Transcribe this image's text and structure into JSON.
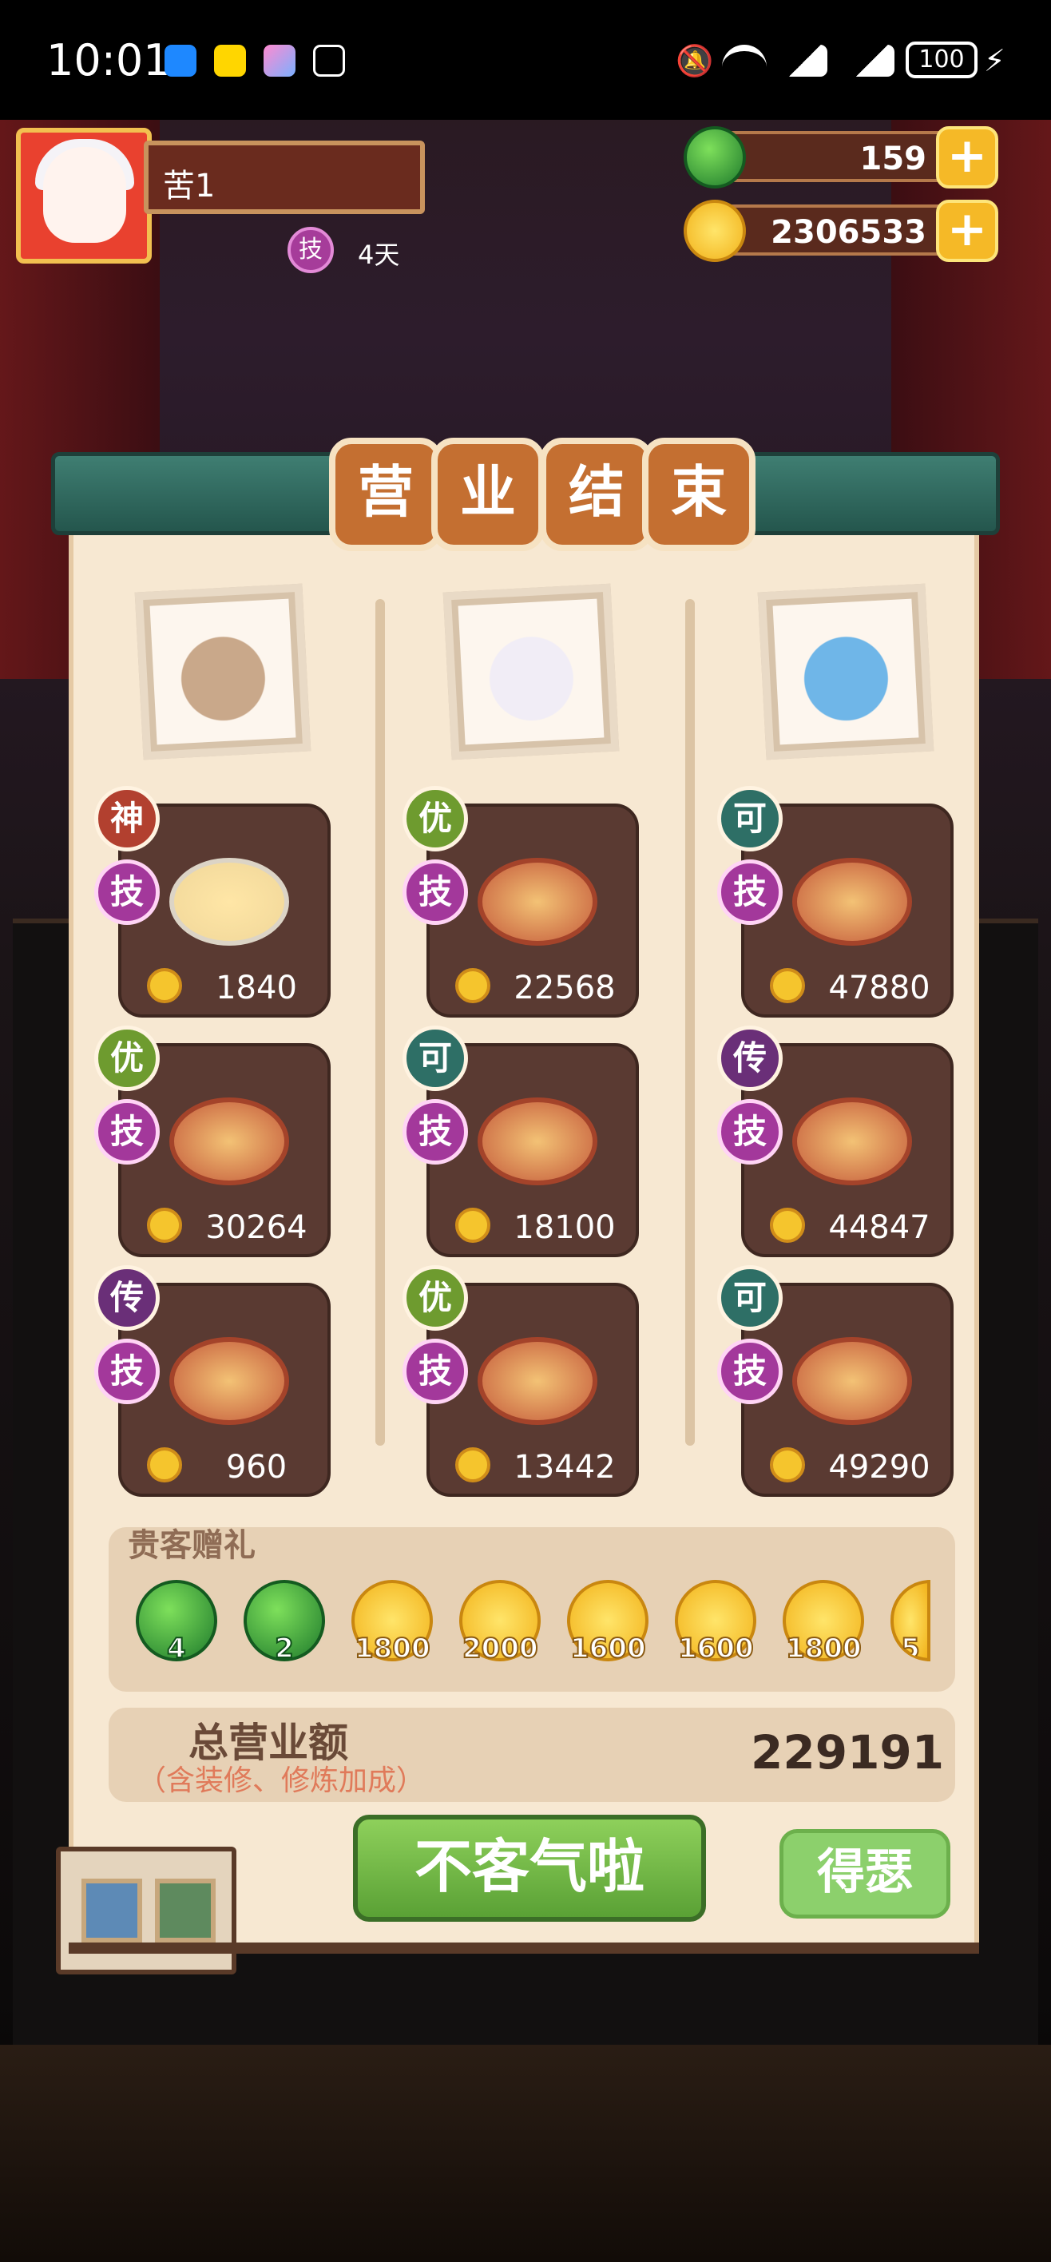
{
  "status_bar": {
    "time": "10:01",
    "left_icons": [
      "messages-icon",
      "meituan-icon",
      "gallery-icon",
      "bluetooth-icon"
    ],
    "right_icons": [
      "silent-icon",
      "wifi-icon",
      "signal-icon",
      "signal-icon",
      "battery-icon"
    ],
    "battery": "100"
  },
  "player": {
    "name": "苦1",
    "skill_badge": "技",
    "days": "4天"
  },
  "currency": {
    "jade": "159",
    "coins": "2306533"
  },
  "banner": [
    "营",
    "业",
    "结",
    "束"
  ],
  "chefs": [
    {
      "name": "chef-1",
      "dishes": [
        {
          "grade": "神",
          "grade_color": "#b2402f",
          "skill": "技",
          "price": "1840"
        },
        {
          "grade": "优",
          "grade_color": "#6e9b2f",
          "skill": "技",
          "price": "30264"
        },
        {
          "grade": "传",
          "grade_color": "#6a2f78",
          "skill": "技",
          "price": "960"
        }
      ]
    },
    {
      "name": "chef-2",
      "dishes": [
        {
          "grade": "优",
          "grade_color": "#6e9b2f",
          "skill": "技",
          "price": "22568"
        },
        {
          "grade": "可",
          "grade_color": "#2e6f66",
          "skill": "技",
          "price": "18100"
        },
        {
          "grade": "优",
          "grade_color": "#6e9b2f",
          "skill": "技",
          "price": "13442"
        }
      ]
    },
    {
      "name": "chef-3",
      "dishes": [
        {
          "grade": "可",
          "grade_color": "#2e6f66",
          "skill": "技",
          "price": "47880"
        },
        {
          "grade": "传",
          "grade_color": "#6a2f78",
          "skill": "技",
          "price": "44847"
        },
        {
          "grade": "可",
          "grade_color": "#2e6f66",
          "skill": "技",
          "price": "49290"
        }
      ]
    }
  ],
  "gifts": {
    "title": "贵客赠礼",
    "items": [
      {
        "type": "jade",
        "amount": "4"
      },
      {
        "type": "jade",
        "amount": "2"
      },
      {
        "type": "gold",
        "amount": "1800"
      },
      {
        "type": "gold",
        "amount": "2000"
      },
      {
        "type": "gold",
        "amount": "1600"
      },
      {
        "type": "gold",
        "amount": "1600"
      },
      {
        "type": "gold",
        "amount": "1800"
      },
      {
        "type": "gold",
        "amount": "5"
      }
    ]
  },
  "total": {
    "label": "总营业额",
    "sublabel": "（含装修、修炼加成）",
    "value": "229191"
  },
  "buttons": {
    "main": "不客气啦",
    "secondary": "得瑟"
  }
}
